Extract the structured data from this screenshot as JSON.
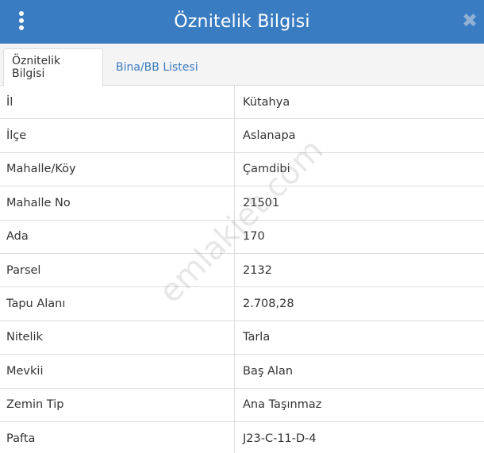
{
  "header": {
    "title": "Öznitelik Bilgisi",
    "menu_icon": "kebab-menu-icon",
    "close_icon": "close-icon",
    "close_glyph": "✖"
  },
  "tabs": [
    {
      "label": "Öznitelik Bilgisi",
      "active": true
    },
    {
      "label": "Bina/BB Listesi",
      "active": false
    }
  ],
  "attributes": [
    {
      "key": "İl",
      "value": "Kütahya"
    },
    {
      "key": "İlçe",
      "value": "Aslanapa"
    },
    {
      "key": "Mahalle/Köy",
      "value": "Çamdibi"
    },
    {
      "key": "Mahalle No",
      "value": "21501"
    },
    {
      "key": "Ada",
      "value": "170"
    },
    {
      "key": "Parsel",
      "value": "2132"
    },
    {
      "key": "Tapu Alanı",
      "value": "2.708,28"
    },
    {
      "key": "Nitelik",
      "value": "Tarla"
    },
    {
      "key": "Mevkii",
      "value": "Baş Alan"
    },
    {
      "key": "Zemin Tip",
      "value": "Ana Taşınmaz"
    },
    {
      "key": "Pafta",
      "value": "J23-C-11-D-4"
    }
  ],
  "watermark": "emlakjet.com",
  "colors": {
    "header_bg": "#3a7cc1",
    "tab_link": "#3a7cc1",
    "text": "#333333"
  }
}
